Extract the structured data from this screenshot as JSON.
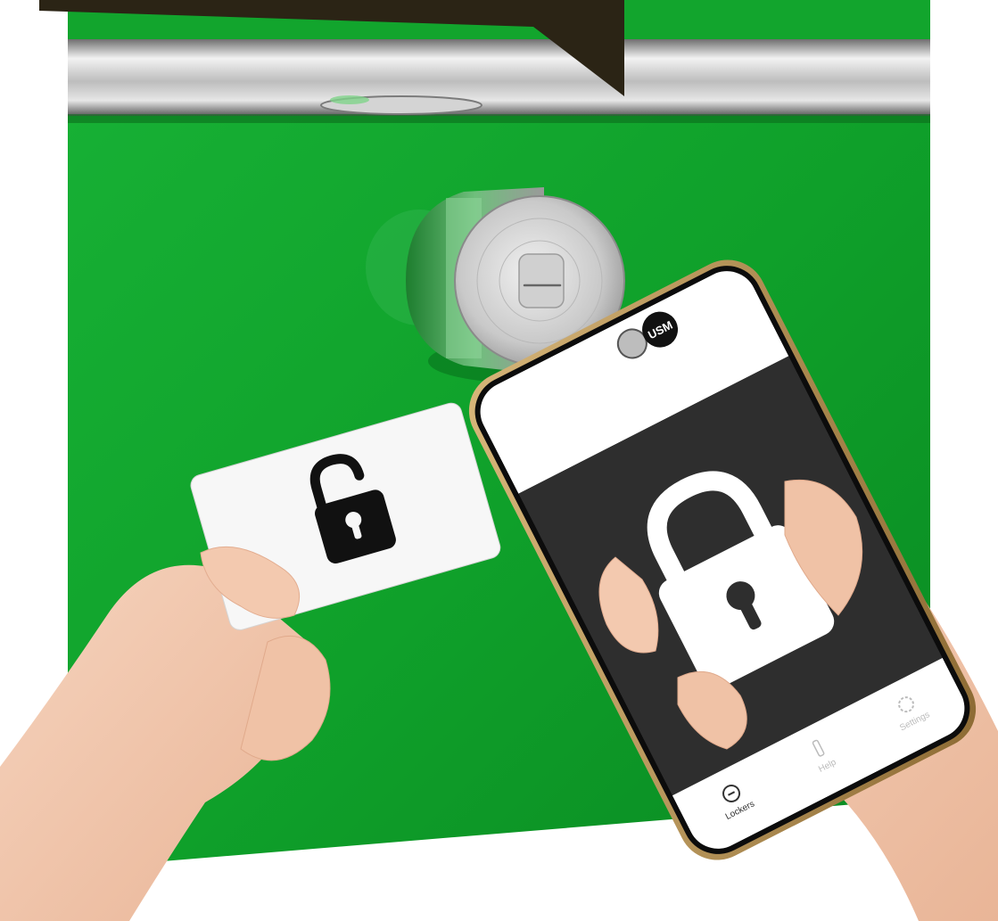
{
  "scene": {
    "description_colors": {
      "cabinet_green": "#13a32b",
      "cabinet_green_dark": "#0a8a22",
      "bar_dark": "#2b2415",
      "lock_silver": "#c8c8c8",
      "phone_screen_dark": "#2e2e2e",
      "card_white": "#f7f7f7",
      "skin": "#f1c7ad"
    },
    "icons": {
      "card_icon": "unlocked-padlock-icon",
      "phone_icon": "locked-padlock-icon",
      "phone_logo": "USM"
    }
  },
  "phone": {
    "logo_text": "USM",
    "tabs": [
      {
        "label": "Lockers",
        "icon": "lockers-icon"
      },
      {
        "label": "Help",
        "icon": "help-icon"
      },
      {
        "label": "Settings",
        "icon": "gear-icon"
      }
    ]
  }
}
